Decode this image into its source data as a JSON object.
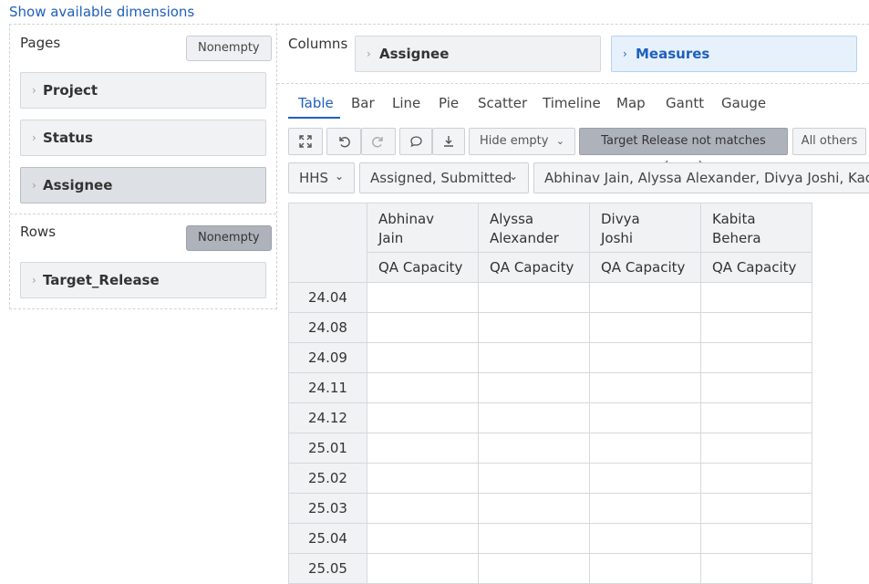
{
  "top_link": "Show available dimensions",
  "pages": {
    "title": "Pages",
    "nonempty_label": "Nonempty",
    "items": [
      "Project",
      "Status",
      "Assignee"
    ]
  },
  "rows_section": {
    "title": "Rows",
    "nonempty_label": "Nonempty",
    "items": [
      "Target_Release"
    ]
  },
  "columns_section": {
    "title": "Columns",
    "items": [
      "Assignee",
      "Measures"
    ]
  },
  "view_tabs": [
    "Table",
    "Bar",
    "Line",
    "Pie",
    "Scatter",
    "Timeline",
    "Map",
    "Gantt",
    "Gauge"
  ],
  "active_tab": "Table",
  "toolbar": {
    "hide_empty_label": "Hide empty",
    "filter_label": "Target Release not matches (none)",
    "all_others_label": "All others"
  },
  "filters": {
    "project": "HHS",
    "status": "Assigned, Submitted",
    "assignee": "Abhinav Jain, Alyssa Alexander, Divya Joshi, Kaoutar"
  },
  "table": {
    "columns": [
      {
        "first": "Abhinav",
        "last": "Jain",
        "measure": "QA Capacity"
      },
      {
        "first": "Alyssa",
        "last": "Alexander",
        "measure": "QA Capacity"
      },
      {
        "first": "Divya",
        "last": "Joshi",
        "measure": "QA Capacity"
      },
      {
        "first": "Kabita",
        "last": "Behera",
        "measure": "QA Capacity"
      }
    ],
    "rows": [
      "24.04",
      "24.08",
      "24.09",
      "24.11",
      "24.12",
      "25.01",
      "25.02",
      "25.03",
      "25.04",
      "25.05"
    ]
  },
  "colors": {
    "accent": "#1f5fbf",
    "measures_bg": "#e6f1fc",
    "active_button": "#aeb3bb"
  }
}
